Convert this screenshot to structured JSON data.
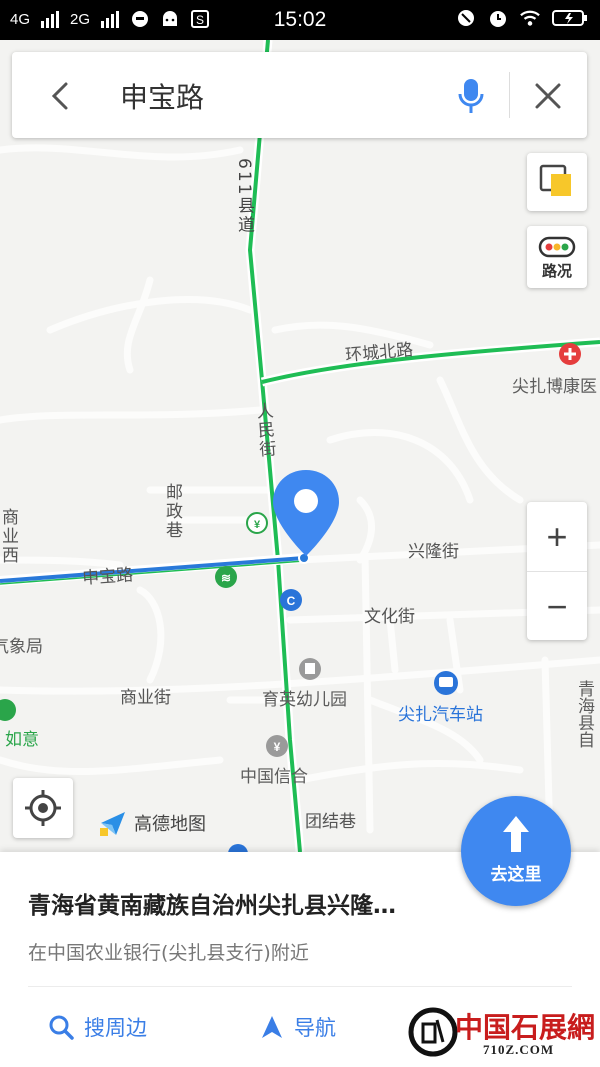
{
  "status_bar": {
    "network_left": "4G",
    "network_right": "2G",
    "time": "15:02"
  },
  "search": {
    "query": "申宝路"
  },
  "map": {
    "roads": {
      "county_road": "611县道",
      "ring_north": "环城北路",
      "renmin": "人民街",
      "youzheng": "邮政巷",
      "shenbao": "申宝路",
      "xinglong": "兴隆街",
      "wenhua": "文化街",
      "shangye": "商业街",
      "tuanjie": "团结巷",
      "shangye_xi": "商业西"
    },
    "pois": {
      "hospital": "尖扎博康医",
      "kindergarten": "育英幼儿园",
      "bus_station": "尖扎汽车站",
      "credit": "中国信合",
      "weather": "气象局",
      "ruyi": "如意",
      "county_right": "青海县自"
    },
    "traffic_label": "路况",
    "brand": "高德地图"
  },
  "go_button": {
    "label": "去这里"
  },
  "card": {
    "title": "青海省黄南藏族自治州尖扎县兴隆…",
    "subtitle": "在中国农业银行(尖扎县支行)附近",
    "actions": [
      {
        "label": "搜周边",
        "icon": "search-icon"
      },
      {
        "label": "导航",
        "icon": "navigation-arrow-icon"
      }
    ]
  },
  "watermark": {
    "text": "中国石展網",
    "url": "710Z.COM"
  },
  "colors": {
    "route_green": "#1fbd55",
    "route_blue": "#2979d9",
    "accent": "#3f88f0",
    "poi_blue": "#2a74d9"
  }
}
